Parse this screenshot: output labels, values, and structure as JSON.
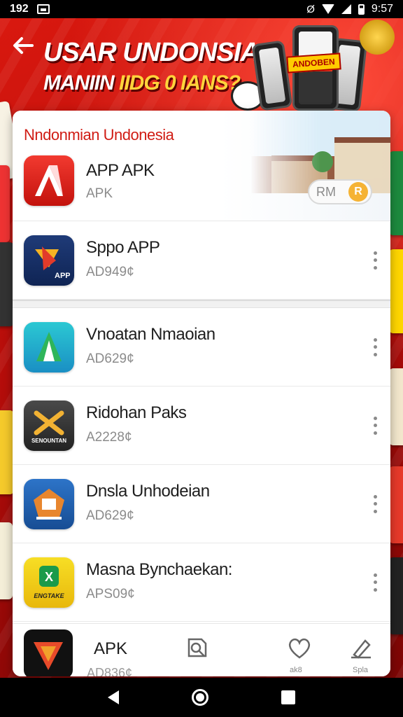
{
  "status_bar": {
    "time": "192",
    "clock": "9:57"
  },
  "header": {
    "title": "USAR UNDONSIA",
    "subtitle_white": "MANIIN ",
    "subtitle_yellow": "IIDG 0 IANS?",
    "promo_badge": "ANDOBEN"
  },
  "panel": {
    "title": "Nndonmian Undonesia",
    "toggle_label": "RM",
    "toggle_knob": "R"
  },
  "apps": [
    {
      "name": "APP APK",
      "sub": "APK",
      "icon": "red-app-icon",
      "has_menu": false
    },
    {
      "name": "Sppo APP",
      "sub": "AD949¢",
      "icon": "navy-app-icon",
      "icon_text": "APP",
      "has_menu": true
    },
    {
      "name": "Vnoatan Nmaoian",
      "sub": "AD629¢",
      "icon": "teal-app-icon",
      "has_menu": true
    },
    {
      "name": "Ridohan Paks",
      "sub": "A2228¢",
      "icon": "dark-app-icon",
      "icon_text": "SENOUNTAN",
      "has_menu": true
    },
    {
      "name": "Dnsla Unhodeian",
      "sub": "AD629¢",
      "icon": "blue-app-icon",
      "has_menu": true
    },
    {
      "name": "Masna Bynchaekan:",
      "sub": "APS09¢",
      "icon": "yellow-app-icon",
      "icon_text": "ENGTAKE",
      "has_menu": true
    }
  ],
  "bottom_nav": {
    "label": "APK",
    "sub": "AD836¢",
    "cap_search": "",
    "cap_heart": "ak8",
    "cap_edit": "Spla"
  },
  "colors": {
    "accent_red": "#d01c14",
    "hero_red": "#c8120b",
    "highlight_yellow": "#ffd43b"
  }
}
